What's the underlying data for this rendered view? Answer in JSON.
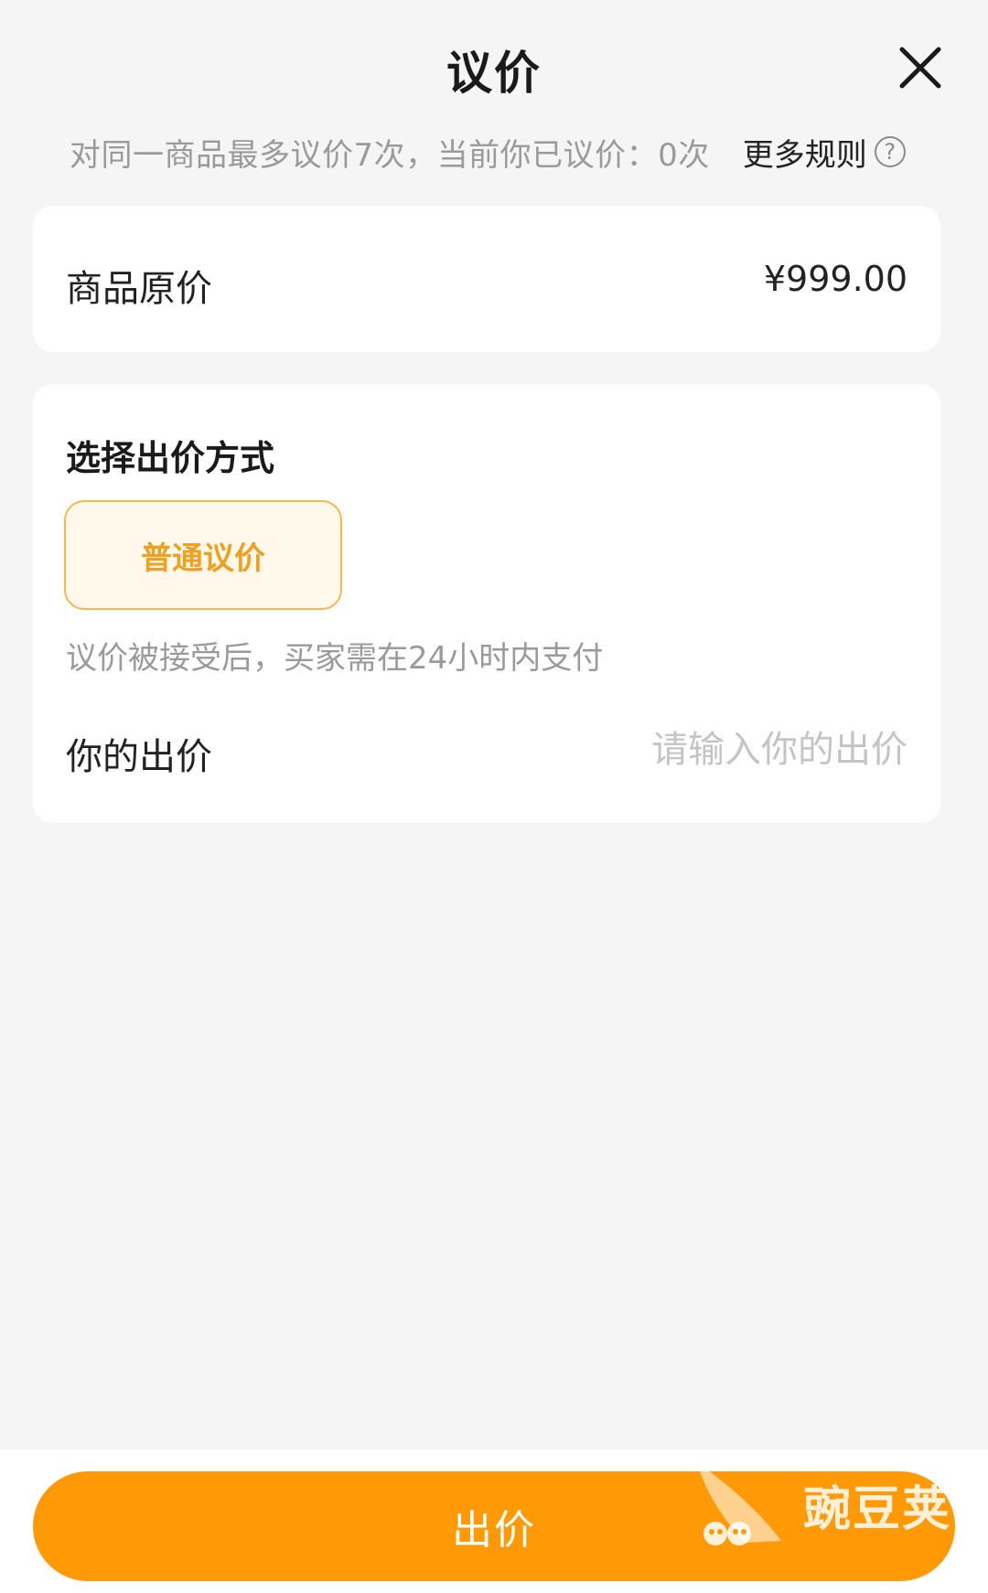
{
  "header": {
    "title": "议价",
    "close_icon": "close-icon"
  },
  "rules": {
    "text": "对同一商品最多议价7次，当前你已议价：0次",
    "more_label": "更多规则",
    "help_icon": "question-circle-icon",
    "help_glyph": "?"
  },
  "price_card": {
    "label": "商品原价",
    "value": "¥999.00"
  },
  "offer_card": {
    "title": "选择出价方式",
    "mode_label": "普通议价",
    "mode_description": "议价被接受后，买家需在24小时内支付",
    "bid_label": "你的出价",
    "bid_placeholder": "请输入你的出价",
    "bid_value": ""
  },
  "footer": {
    "submit_label": "出价"
  },
  "watermark": {
    "text": "豌豆荚",
    "icon": "peapod-logo-icon"
  },
  "colors": {
    "accent": "#ff9a06",
    "mode_border": "#f6b84a",
    "mode_text": "#f0a020",
    "mode_bg": "#fff8eb",
    "muted_text": "#9a9a9a",
    "placeholder": "#c4c4c4",
    "background": "#f5f5f5"
  }
}
